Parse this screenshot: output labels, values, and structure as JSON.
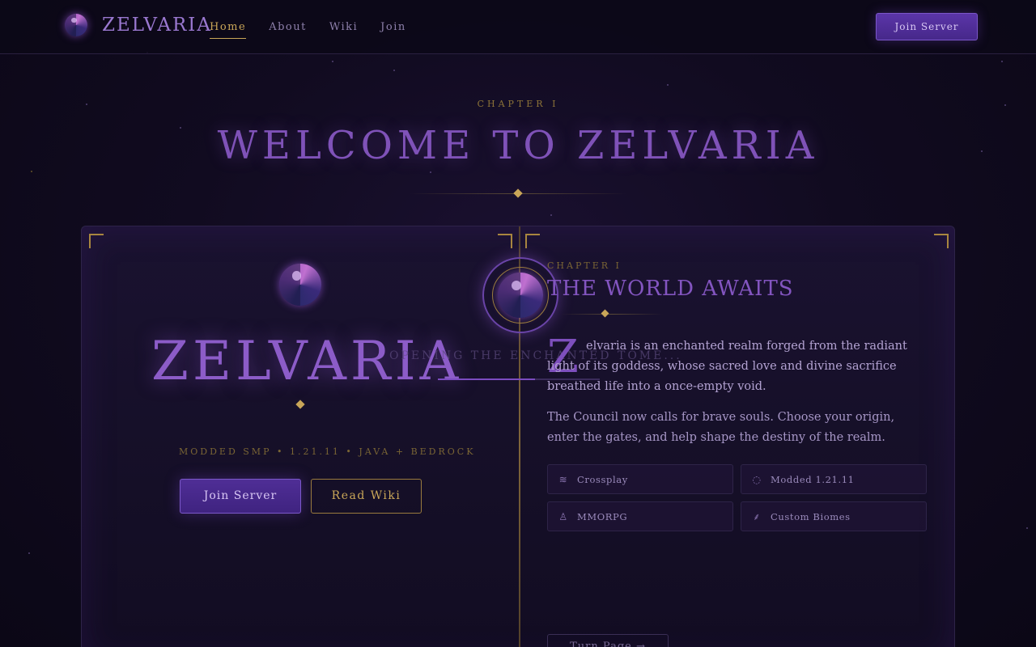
{
  "nav": {
    "brand": "ZELVARIA",
    "links": [
      {
        "label": "Home",
        "active": true
      },
      {
        "label": "About",
        "active": false
      },
      {
        "label": "Wiki",
        "active": false
      },
      {
        "label": "Join",
        "active": false
      }
    ],
    "cta": "Join Server"
  },
  "hero": {
    "chapter": "CHAPTER I",
    "title": "WELCOME TO ZELVARIA"
  },
  "book": {
    "left": {
      "title": "ZELVARIA",
      "subtitle": "MODDED SMP • 1.21.11 • JAVA + BEDROCK",
      "primary_button": "Join Server",
      "secondary_button": "Read Wiki"
    },
    "loading": {
      "text": "OPENING THE ENCHANTED TOME..."
    },
    "right": {
      "chapter": "CHAPTER I",
      "title": "THE WORLD AWAITS",
      "dropcap": "Z",
      "paragraph1": "elvaria is an enchanted realm forged from the radiant light of its goddess, whose sacred love and divine sacrifice breathed life into a once-empty void.",
      "paragraph2": "The Council now calls for brave souls. Choose your origin, enter the gates, and help shape the destiny of the realm.",
      "features": [
        {
          "label": "Crossplay",
          "icon": "layers-icon"
        },
        {
          "label": "Modded 1.21.11",
          "icon": "lightbulb-icon"
        },
        {
          "label": "MMORPG",
          "icon": "user-icon"
        },
        {
          "label": "Custom Biomes",
          "icon": "sprout-icon"
        }
      ],
      "turn_page": "Turn Page →"
    }
  },
  "colors": {
    "accent_purple": "#7f52b8",
    "accent_gold": "#c9a658",
    "background": "#110b20"
  }
}
